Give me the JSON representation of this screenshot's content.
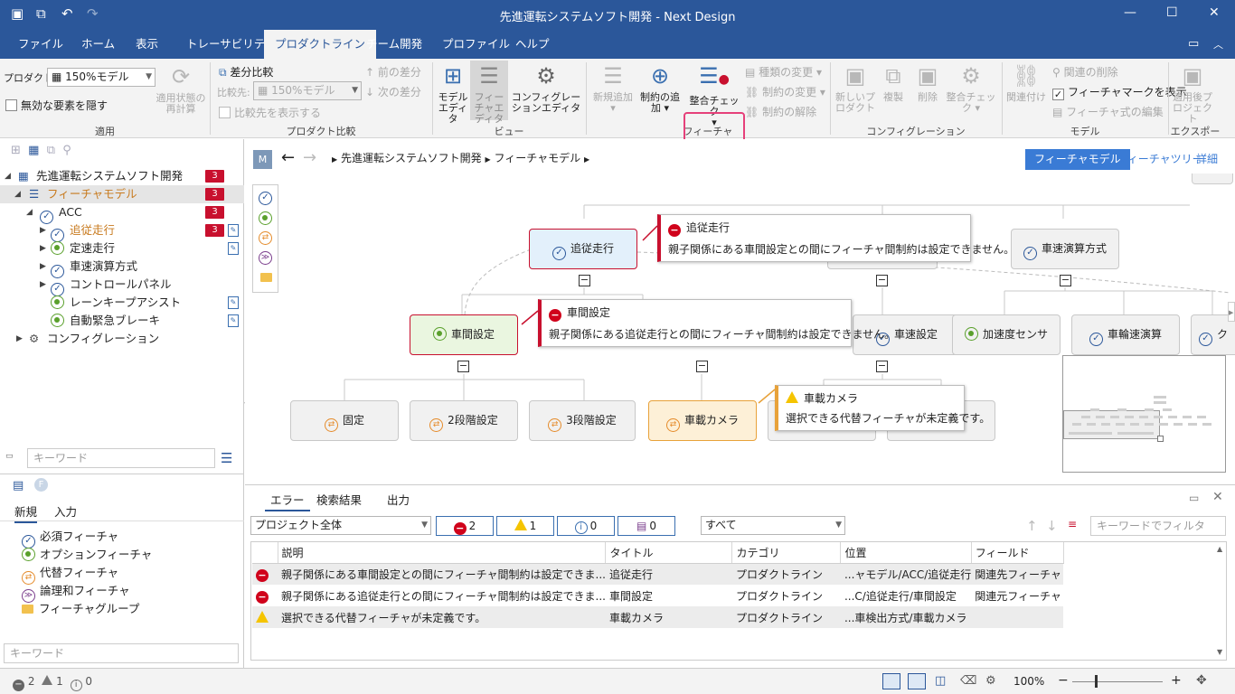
{
  "window": {
    "title": "先進運転システムソフト開発 - Next Design"
  },
  "menu": [
    "ファイル",
    "ホーム",
    "表示",
    "トレーサビリティ",
    "プロダクトライン",
    "チーム開発",
    "プロファイル",
    "ヘルプ"
  ],
  "ribbon": {
    "apply": {
      "product_label": "プロダクト:",
      "product_value": "150%モデル",
      "hide_invalid": "無効な要素を隠す",
      "recalc": "適用状態の再計算",
      "group": "適用"
    },
    "compare": {
      "diff": "差分比較",
      "target_label": "比較先:",
      "target_value": "150%モデル",
      "show_target": "比較先を表示する",
      "prev": "前の差分",
      "next": "次の差分",
      "group": "プロダクト比較"
    },
    "view": {
      "model_editor": "モデルエディタ",
      "feature_editor": "フィーチャエディタ",
      "config_editor": "コンフィグレーションエディタ",
      "group": "ビュー"
    },
    "feature": {
      "new_add": "新規追加",
      "add_constraint": "制約の追加",
      "consistency": "整合チェック",
      "change_kind": "種類の変更",
      "change_constraint": "制約の変更",
      "remove_constraint": "制約の解除",
      "group": "フィーチャ"
    },
    "config": {
      "new_product": "新しいプロダクト",
      "duplicate": "複製",
      "delete": "削除",
      "consistency": "整合チェック",
      "group": "コンフィグレーション"
    },
    "model": {
      "link": "関連付け",
      "remove_link": "関連の削除",
      "show_mark": "フィーチャマークを表示",
      "edit_expr": "フィーチャ式の編集",
      "group": "モデル"
    },
    "export": {
      "applied_project": "適用後プロジェクト",
      "group": "エクスポート"
    }
  },
  "tree": [
    {
      "label": "先進運転システムソフト開発",
      "badge": "3"
    },
    {
      "label": "フィーチャモデル",
      "badge": "3"
    },
    {
      "label": "ACC",
      "badge": "3"
    },
    {
      "label": "追従走行",
      "badge": "3"
    },
    {
      "label": "定速走行",
      "badge": ""
    },
    {
      "label": "車速演算方式",
      "badge": ""
    },
    {
      "label": "コントロールパネル",
      "badge": ""
    },
    {
      "label": "レーンキープアシスト",
      "badge": ""
    },
    {
      "label": "自動緊急ブレーキ",
      "badge": ""
    },
    {
      "label": "コンフィグレーション",
      "badge": ""
    }
  ],
  "left_search_placeholder": "キーワード",
  "palette": {
    "tabs": [
      "新規",
      "入力"
    ],
    "items": [
      "必須フィーチャ",
      "オプションフィーチャ",
      "代替フィーチャ",
      "論理和フィーチャ",
      "フィーチャグループ"
    ],
    "search_placeholder": "キーワード"
  },
  "editor": {
    "breadcrumb": [
      "先進運転システムソフト開発",
      "フィーチャモデル"
    ],
    "view_tabs": [
      "フィーチャモデル",
      "フィーチャツリー",
      "詳細"
    ],
    "m_label": "M",
    "nodes": {
      "n1": "追従走行",
      "n2": "車速演算方式",
      "n3": "車間設定",
      "n4": "車速設定",
      "n5": "加速度センサ",
      "n6": "車輪速演算",
      "n7": "ク",
      "n8": "固定",
      "n9": "2段階設定",
      "n10": "3段階設定",
      "n11": "車載カメラ"
    },
    "callouts": {
      "c1_title": "追従走行",
      "c1_msg": "親子関係にある車間設定との間にフィーチャ間制約は設定できません。",
      "c2_title": "車間設定",
      "c2_msg": "親子関係にある追従走行との間にフィーチャ間制約は設定できません。",
      "c3_title": "車載カメラ",
      "c3_msg": "選択できる代替フィーチャが未定義です。"
    }
  },
  "bottom": {
    "tabs": [
      "エラー",
      "検索結果",
      "出力"
    ],
    "scope": "プロジェクト全体",
    "counts": {
      "error": "2",
      "warning": "1",
      "info": "0",
      "other": "0"
    },
    "category": "すべて",
    "filter_placeholder": "キーワードでフィルタ",
    "columns": [
      "説明",
      "タイトル",
      "カテゴリ",
      "位置",
      "フィールド"
    ],
    "rows": [
      {
        "type": "error",
        "desc": "親子関係にある車間設定との間にフィーチャ間制約は設定できま...",
        "title": "追従走行",
        "cat": "プロダクトライン",
        "pos": "...ャモデル/ACC/追従走行",
        "field": "関連先フィーチャ"
      },
      {
        "type": "error",
        "desc": "親子関係にある追従走行との間にフィーチャ間制約は設定できま...",
        "title": "車間設定",
        "cat": "プロダクトライン",
        "pos": "...C/追従走行/車間設定",
        "field": "関連元フィーチャ"
      },
      {
        "type": "warning",
        "desc": "選択できる代替フィーチャが未定義です。",
        "title": "車載カメラ",
        "cat": "プロダクトライン",
        "pos": "...車検出方式/車載カメラ",
        "field": ""
      }
    ]
  },
  "status": {
    "errors": "2",
    "warnings": "1",
    "infos": "0",
    "zoom": "100%"
  }
}
